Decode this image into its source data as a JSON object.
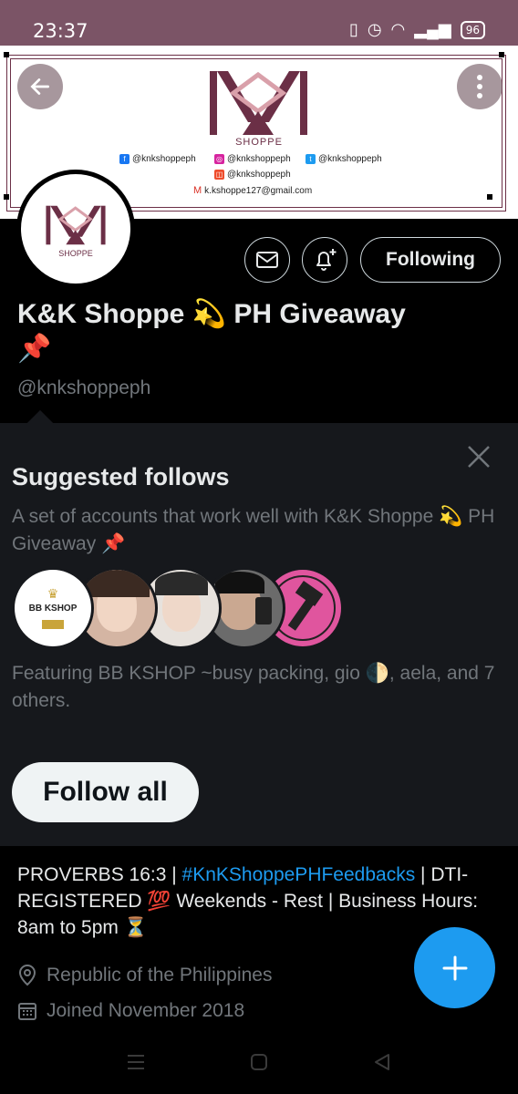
{
  "status_bar": {
    "time": "23:37",
    "battery": "96"
  },
  "banner": {
    "logo_text": "SHOPPE",
    "facebook": "@knkshoppeph",
    "instagram": "@knkshoppeph",
    "twitter": "@knkshoppeph",
    "shop": "@knkshoppeph",
    "email": "k.kshoppe127@gmail.com"
  },
  "profile": {
    "avatar_text": "SHOPPE",
    "name_line1": "K&K Shoppe 💫 PH Giveaway",
    "name_line2": "📌",
    "handle": "@knkshoppeph",
    "following_label": "Following"
  },
  "suggested": {
    "title": "Suggested follows",
    "description": "A set of accounts that work well with K&K Shoppe 💫 PH Giveaway 📌",
    "first_face_text": "BB KSHOP",
    "featuring": "Featuring BB KSHOP ~busy packing, gio 🌓, aela, and 7 others.",
    "follow_all_label": "Follow all"
  },
  "bio": {
    "part1": "PROVERBS 16:3 | ",
    "hashtag": "#KnKShoppePHFeedbacks",
    "part2": " | DTI-REGISTERED 💯 Weekends - Rest | Business Hours: 8am to 5pm ⏳",
    "location": "Republic of the Philippines",
    "joined": "Joined November 2018"
  },
  "colors": {
    "accent": "#1d9bf0",
    "brand": "#6b2f46",
    "status_bar": "#7b5466"
  },
  "icons": {
    "back": "arrow-left-icon",
    "more": "more-vertical-icon",
    "message": "mail-icon",
    "notify": "bell-plus-icon",
    "close": "close-icon",
    "location": "location-pin-icon",
    "calendar": "calendar-icon",
    "compose": "plus-icon"
  }
}
